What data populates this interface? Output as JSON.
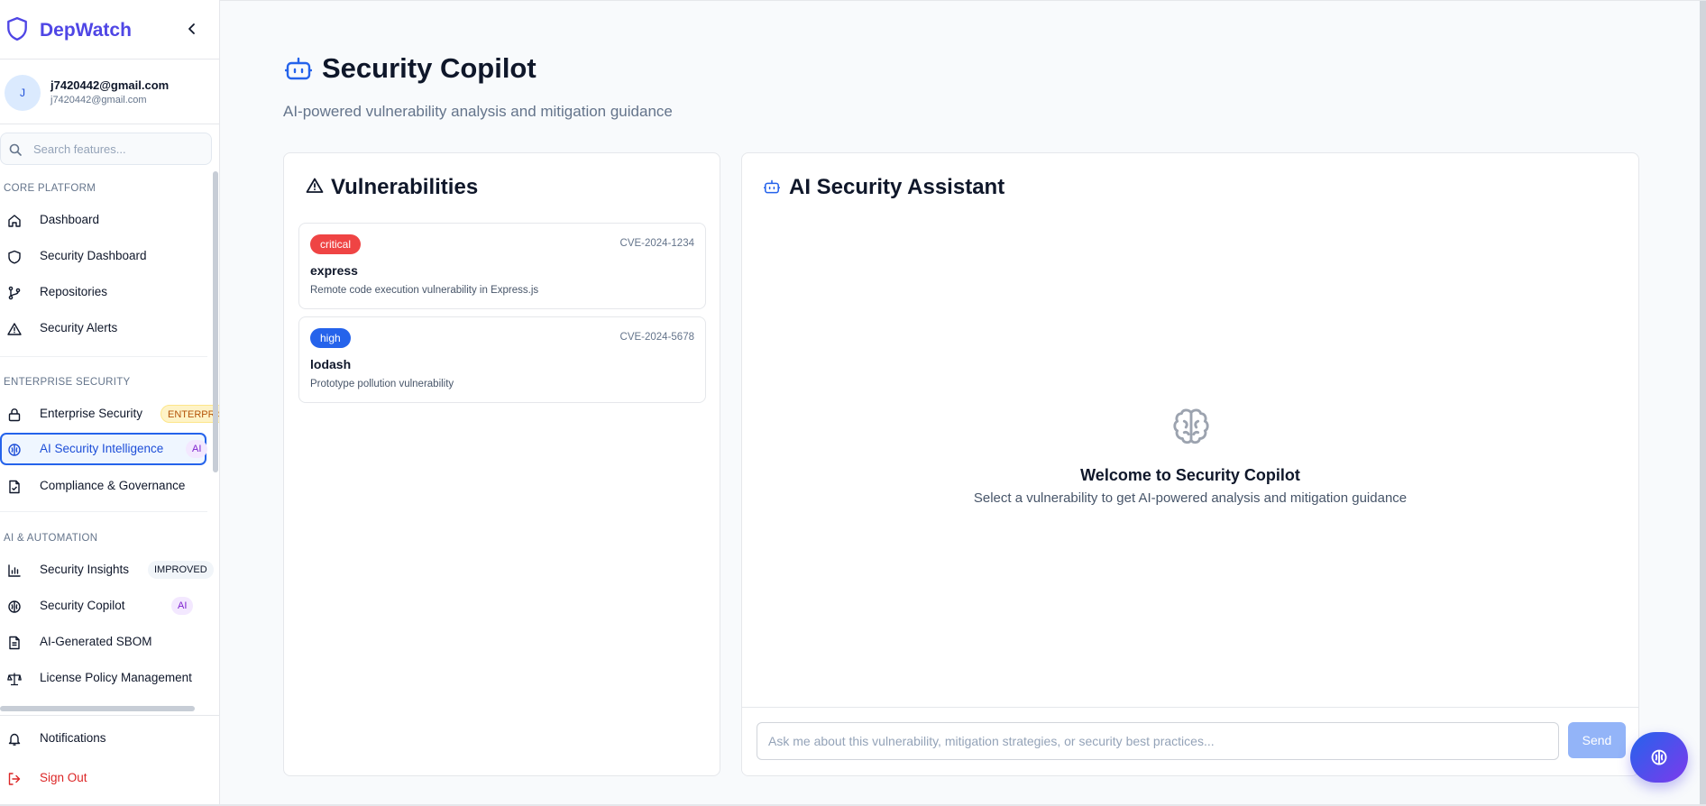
{
  "brand": {
    "name": "DepWatch"
  },
  "user": {
    "initial": "J",
    "name": "j7420442@gmail.com",
    "email": "j7420442@gmail.com"
  },
  "search": {
    "placeholder": "Search features..."
  },
  "sidebar": {
    "sections": [
      {
        "title": "CORE PLATFORM",
        "items": [
          {
            "label": "Dashboard",
            "icon": "home-icon"
          },
          {
            "label": "Security Dashboard",
            "icon": "shield-icon"
          },
          {
            "label": "Repositories",
            "icon": "git-branch-icon"
          },
          {
            "label": "Security Alerts",
            "icon": "alert-triangle-icon"
          }
        ]
      },
      {
        "title": "ENTERPRISE SECURITY",
        "items": [
          {
            "label": "Enterprise Security",
            "icon": "lock-icon",
            "badge": "ENTERPRISE"
          },
          {
            "label": "AI Security Intelligence",
            "icon": "brain-icon",
            "badge": "AI",
            "active": true
          },
          {
            "label": "Compliance & Governance",
            "icon": "file-check-icon"
          }
        ]
      },
      {
        "title": "AI & AUTOMATION",
        "items": [
          {
            "label": "Security Insights",
            "icon": "bar-chart-icon",
            "badge": "IMPROVED"
          },
          {
            "label": "Security Copilot",
            "icon": "brain-icon",
            "badge": "AI"
          },
          {
            "label": "AI-Generated SBOM",
            "icon": "file-text-icon"
          },
          {
            "label": "License Policy Management",
            "icon": "scale-icon"
          }
        ]
      }
    ],
    "bottom": [
      {
        "label": "Notifications",
        "icon": "bell-icon"
      },
      {
        "label": "Sign Out",
        "icon": "log-out-icon"
      }
    ]
  },
  "page": {
    "title": "Security Copilot",
    "subtitle": "AI-powered vulnerability analysis and mitigation guidance"
  },
  "vulnerabilities": {
    "heading": "Vulnerabilities",
    "items": [
      {
        "severity": "critical",
        "cve": "CVE-2024-1234",
        "package": "express",
        "description": "Remote code execution vulnerability in Express.js"
      },
      {
        "severity": "high",
        "cve": "CVE-2024-5678",
        "package": "lodash",
        "description": "Prototype pollution vulnerability"
      }
    ]
  },
  "assistant": {
    "heading": "AI Security Assistant",
    "empty_title": "Welcome to Security Copilot",
    "empty_text": "Select a vulnerability to get AI-powered analysis and mitigation guidance",
    "input_placeholder": "Ask me about this vulnerability, mitigation strategies, or security best practices...",
    "send_label": "Send"
  },
  "colors": {
    "brand": "#4f46e5",
    "primary": "#2563eb",
    "critical": "#ef4444",
    "high": "#2563eb",
    "send_disabled": "#93b4f8"
  }
}
